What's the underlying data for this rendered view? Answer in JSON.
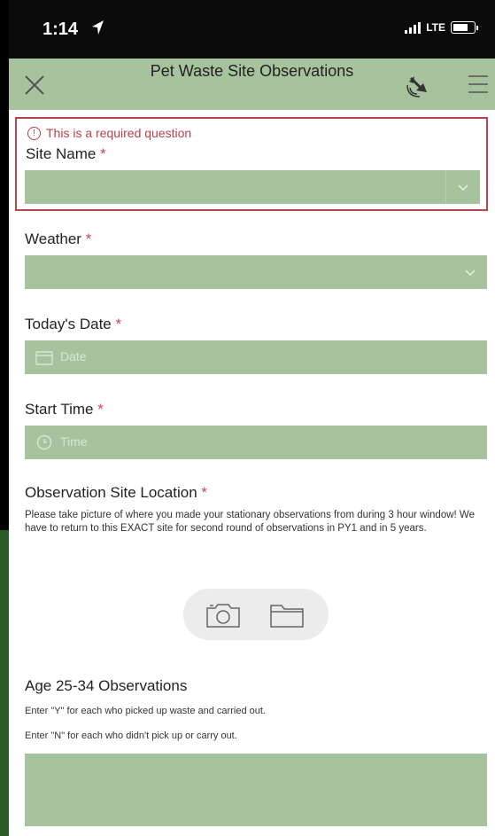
{
  "status_bar": {
    "time": "1:14",
    "network": "LTE"
  },
  "header": {
    "title": "Pet Waste Site Observations",
    "icons": [
      "close-icon",
      "gps-icon",
      "menu-icon"
    ]
  },
  "form": {
    "required_message": "This is a required question",
    "site_name": {
      "label": "Site Name",
      "required_mark": "*",
      "value": ""
    },
    "weather": {
      "label": "Weather",
      "required_mark": "*",
      "value": ""
    },
    "todays_date": {
      "label": "Today's Date",
      "required_mark": "*",
      "placeholder": "Date"
    },
    "start_time": {
      "label": "Start Time",
      "required_mark": "*",
      "placeholder": "Time"
    },
    "observation_site_location": {
      "label": "Observation Site Location",
      "required_mark": "*",
      "description": "Please take picture of where you made your stationary observations from during 3 hour window! We have to return to this EXACT site for second round of observations in PY1 and in 5 years."
    },
    "age_25_34": {
      "label": "Age 25-34 Observations",
      "hint_y": "Enter \"Y\" for each who picked up waste and carried out.",
      "hint_n": "Enter \"N\" for each who didn't pick up or carry out.",
      "value": ""
    }
  },
  "colors": {
    "field_green": "#a6c39e",
    "error_red": "#b9434b",
    "background_dark_green": "#2d5a2b"
  }
}
